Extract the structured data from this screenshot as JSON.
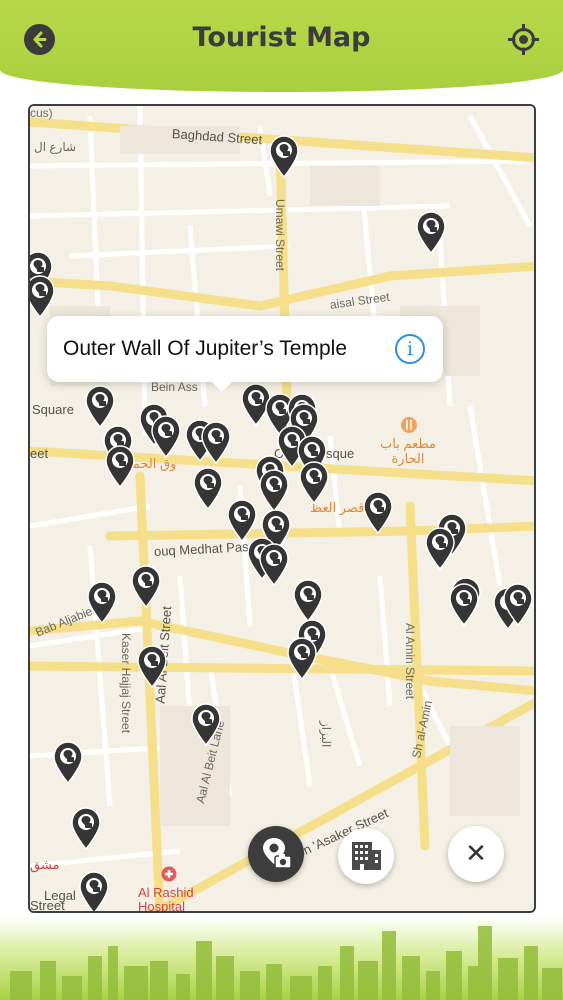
{
  "header": {
    "title": "Tourist Map",
    "back_icon": "back-arrow-icon",
    "locate_icon": "crosshair-location-icon"
  },
  "map": {
    "streets": {
      "baghdad": "Baghdad Street",
      "umawi": "Umawi Street",
      "faisal": "aisal Street",
      "square": "Square",
      "eet": "eet",
      "bein": "Bein Ass",
      "souq_medhat": "ouq Medhat Pas",
      "bab_aljabieh": "Bab Aljabieh",
      "kaser_hajjaj": "Kaser Hajjaj Street",
      "aal_al_beit_street": "Aal Al Beit Street",
      "aal_al_beit_lane": "Aal Al Beit Lane",
      "al_amin": "Al Amin Street",
      "sh_al_amin": "Sh al-Amin",
      "ibn_asaker": "Ibn 'Asaker Street",
      "legal": "Legal",
      "street_bl": "Street",
      "cus": "cus)",
      "arabic_street": "شارع ال",
      "mosque": "O",
      "mosque2": "sque",
      "arabic_hamidiyeh": "وق الحميدي",
      "arabic_qasr": "قصر العظ",
      "arabic_restaurant": "مطعم باب\nالحارة",
      "arabic_bazzaz": "البزاز",
      "arabic_mashq": "مشق"
    },
    "hospital": "Al Rashid\nHospital",
    "pin_icon": "camera-marker-pin-icon"
  },
  "callout": {
    "title": "Outer Wall Of Jupiter’s Temple",
    "info_label": "i"
  },
  "actions": {
    "camera_icon": "camera-location-icon",
    "building_icon": "building-icon",
    "close_label": "✕"
  },
  "colors": {
    "header_green": "#a9cf3e",
    "pin_dark": "#343434",
    "info_blue": "#2a8ee8",
    "hospital_red": "#d0434a"
  }
}
